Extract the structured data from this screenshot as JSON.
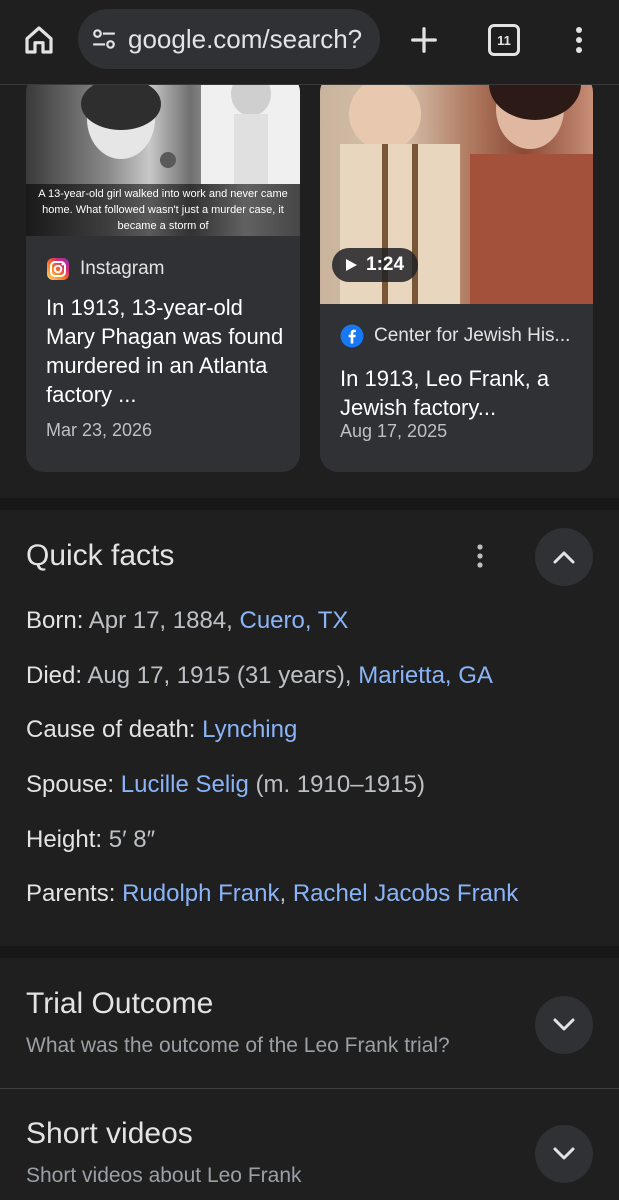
{
  "toolbar": {
    "home_icon": "home-icon",
    "url": "google.com/search?",
    "tab_count": "11",
    "new_tab_icon": "plus-icon",
    "menu_icon": "more-vert-icon"
  },
  "cards": [
    {
      "caption": "A 13-year-old girl walked into work and never came home. What followed wasn't just a murder case, it became a storm of",
      "source": "Instagram",
      "title": "In 1913, 13-year-old Mary Phagan was found murdered in an Atlanta factory ...",
      "date": "Mar 23, 2026"
    },
    {
      "duration": "1:24",
      "source": "Center for Jewish His...",
      "title": "In 1913, Leo Frank, a Jewish factory...",
      "date": "Aug 17, 2025"
    }
  ],
  "quick_facts": {
    "title": "Quick facts",
    "born": {
      "label": "Born",
      "text": "Apr 17, 1884, ",
      "link": "Cuero, TX"
    },
    "died": {
      "label": "Died",
      "text": "Aug 17, 1915 (31 years), ",
      "link": "Marietta, GA"
    },
    "cause": {
      "label": "Cause of death",
      "link": "Lynching"
    },
    "spouse": {
      "label": "Spouse",
      "link": "Lucille Selig",
      "text": " (m. 1910–1915)"
    },
    "height": {
      "label": "Height",
      "text": "5′ 8″"
    },
    "parents": {
      "label": "Parents",
      "link1": "Rudolph Frank",
      "sep": ", ",
      "link2": "Rachel Jacobs Frank"
    }
  },
  "trial": {
    "title": "Trial Outcome",
    "subtitle": "What was the outcome of the Leo Frank trial?"
  },
  "short_videos": {
    "title": "Short videos",
    "subtitle": "Short videos about Leo Frank"
  },
  "colors": {
    "background": "#1f1f1f",
    "card": "#303134",
    "link": "#8ab4f8",
    "muted": "#9aa0a6"
  }
}
